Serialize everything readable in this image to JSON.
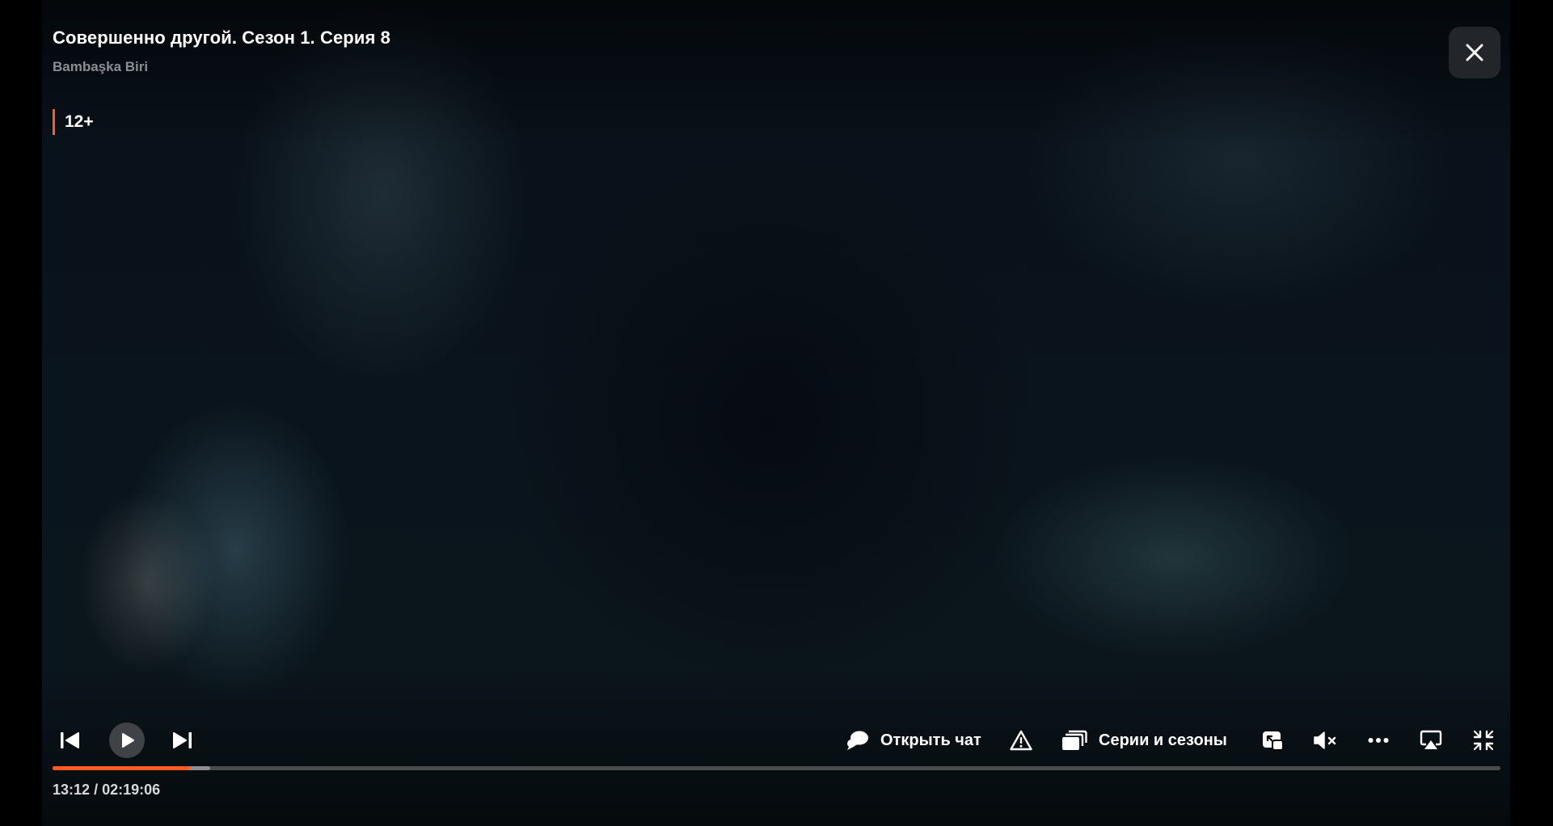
{
  "header": {
    "title": "Совершенно другой. Сезон 1. Серия 8",
    "original_title": "Bambaşka Biri",
    "age_rating": "12+"
  },
  "controls": {
    "chat_label": "Открыть чат",
    "episodes_label": "Серии и сезоны"
  },
  "playback": {
    "current_time": "13:12",
    "separator": "/",
    "duration": "02:19:06",
    "progress_percent": 9.5,
    "buffered_percent": 10.9,
    "state": "paused"
  },
  "colors": {
    "accent": "#ff5a1f",
    "text": "#ffffff",
    "muted_text": "#8a8f95"
  },
  "icons": {
    "close": "close-icon",
    "prev": "previous-episode-icon",
    "play": "play-icon",
    "next": "next-episode-icon",
    "chat": "chat-icon",
    "report": "warning-icon",
    "episodes": "episodes-stack-icon",
    "pip": "picture-in-picture-icon",
    "volume": "volume-muted-icon",
    "more": "more-dots-icon",
    "airplay": "airplay-icon",
    "fullscreen": "exit-fullscreen-icon"
  }
}
